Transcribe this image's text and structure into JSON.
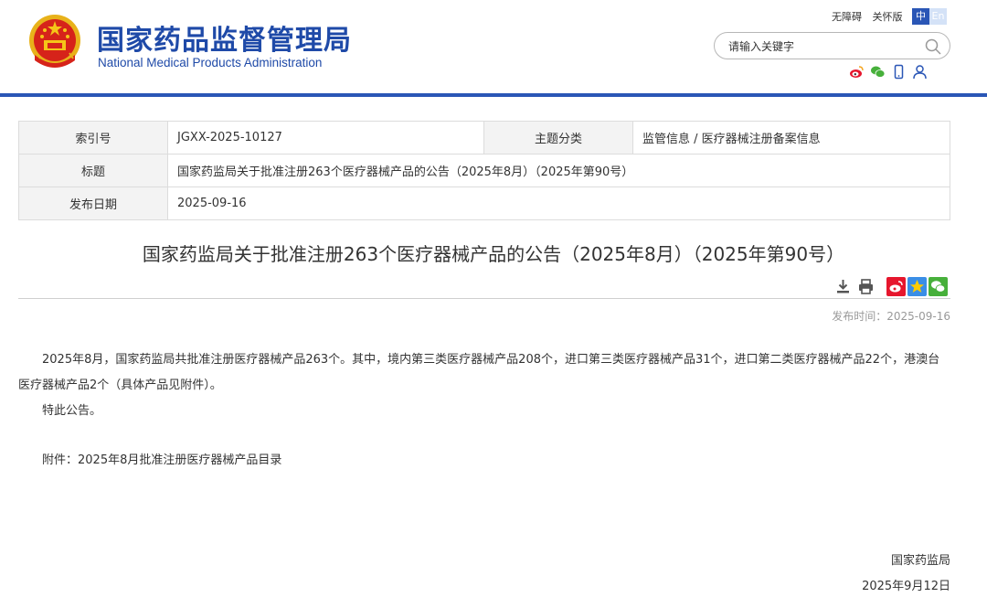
{
  "header": {
    "title_cn": "国家药品监督管理局",
    "title_en": "National Medical Products Administration",
    "links": [
      "无障碍",
      "关怀版"
    ],
    "lang_cn": "中",
    "lang_en": "En",
    "search_placeholder": "请输入关键字",
    "colors": {
      "brand": "#1f4aa8",
      "rule": "#2a56b6"
    }
  },
  "meta": {
    "index_label": "索引号",
    "index_value": "JGXX-2025-10127",
    "topic_label": "主题分类",
    "topic_value": "监管信息 / 医疗器械注册备案信息",
    "title_label": "标题",
    "title_value": "国家药监局关于批准注册263个医疗器械产品的公告（2025年8月）（2025年第90号）",
    "date_label": "发布日期",
    "date_value": "2025-09-16"
  },
  "article": {
    "title": "国家药监局关于批准注册263个医疗器械产品的公告（2025年8月）（2025年第90号）",
    "publish_time": "发布时间：2025-09-16",
    "paragraphs": [
      "2025年8月，国家药监局共批准注册医疗器械产品263个。其中，境内第三类医疗器械产品208个，进口第三类医疗器械产品31个，进口第二类医疗器械产品22个，港澳台医疗器械产品2个（具体产品见附件）。",
      "特此公告。"
    ],
    "attachment": "附件：2025年8月批准注册医疗器械产品目录",
    "signer": "国家药监局",
    "sign_date": "2025年9月12日"
  }
}
